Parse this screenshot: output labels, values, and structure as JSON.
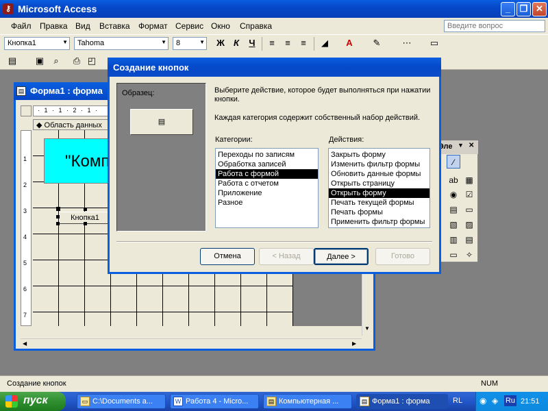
{
  "app": {
    "title": "Microsoft Access",
    "min_glyph": "_",
    "max_glyph": "❐",
    "close_glyph": "✕"
  },
  "menu": {
    "items": [
      "Файл",
      "Правка",
      "Вид",
      "Вставка",
      "Формат",
      "Сервис",
      "Окно",
      "Справка"
    ],
    "help_placeholder": "Введите вопрос"
  },
  "toolbar": {
    "object_combo": "Кнопка1",
    "font_combo": "Tahoma",
    "size_combo": "8",
    "bold": "Ж",
    "italic": "К",
    "underline": "Ч"
  },
  "form_window": {
    "title": "Форма1 : форма",
    "section": "Область данных",
    "label_text": "\"Компь",
    "button_text": "Кнопка1",
    "ruler_top": "· 1 · 1 · 2 · 1 ·",
    "ruler_left_marks": [
      "1",
      "2",
      "3",
      "4",
      "5",
      "6",
      "7"
    ]
  },
  "toolbox": {
    "title": "Эле"
  },
  "dialog": {
    "title": "Создание кнопок",
    "sample_label": "Образец:",
    "instruction1": "Выберите действие, которое будет выполняться при нажатии кнопки.",
    "instruction2": "Каждая категория содержит собственный набор действий.",
    "categories_label": "Категории:",
    "actions_label": "Действия:",
    "categories": [
      "Переходы по записям",
      "Обработка записей",
      "Работа с формой",
      "Работа с отчетом",
      "Приложение",
      "Разное"
    ],
    "selected_category": 2,
    "actions": [
      "Закрыть форму",
      "Изменить фильтр формы",
      "Обновить данные формы",
      "Открыть страницу",
      "Открыть форму",
      "Печать текущей формы",
      "Печать формы",
      "Применить фильтр формы"
    ],
    "selected_action": 4,
    "buttons": {
      "cancel": "Отмена",
      "back": "< Назад",
      "next": "Далее >",
      "finish": "Готово"
    }
  },
  "status": {
    "text": "Создание кнопок",
    "num": "NUM"
  },
  "taskbar": {
    "start": "пуск",
    "tasks": [
      "C:\\Documents a...",
      "Работа 4 - Micro...",
      "Компьютерная ...",
      "Форма1 : форма"
    ],
    "lang": "RL",
    "ru": "Ru",
    "clock": "21:51"
  }
}
